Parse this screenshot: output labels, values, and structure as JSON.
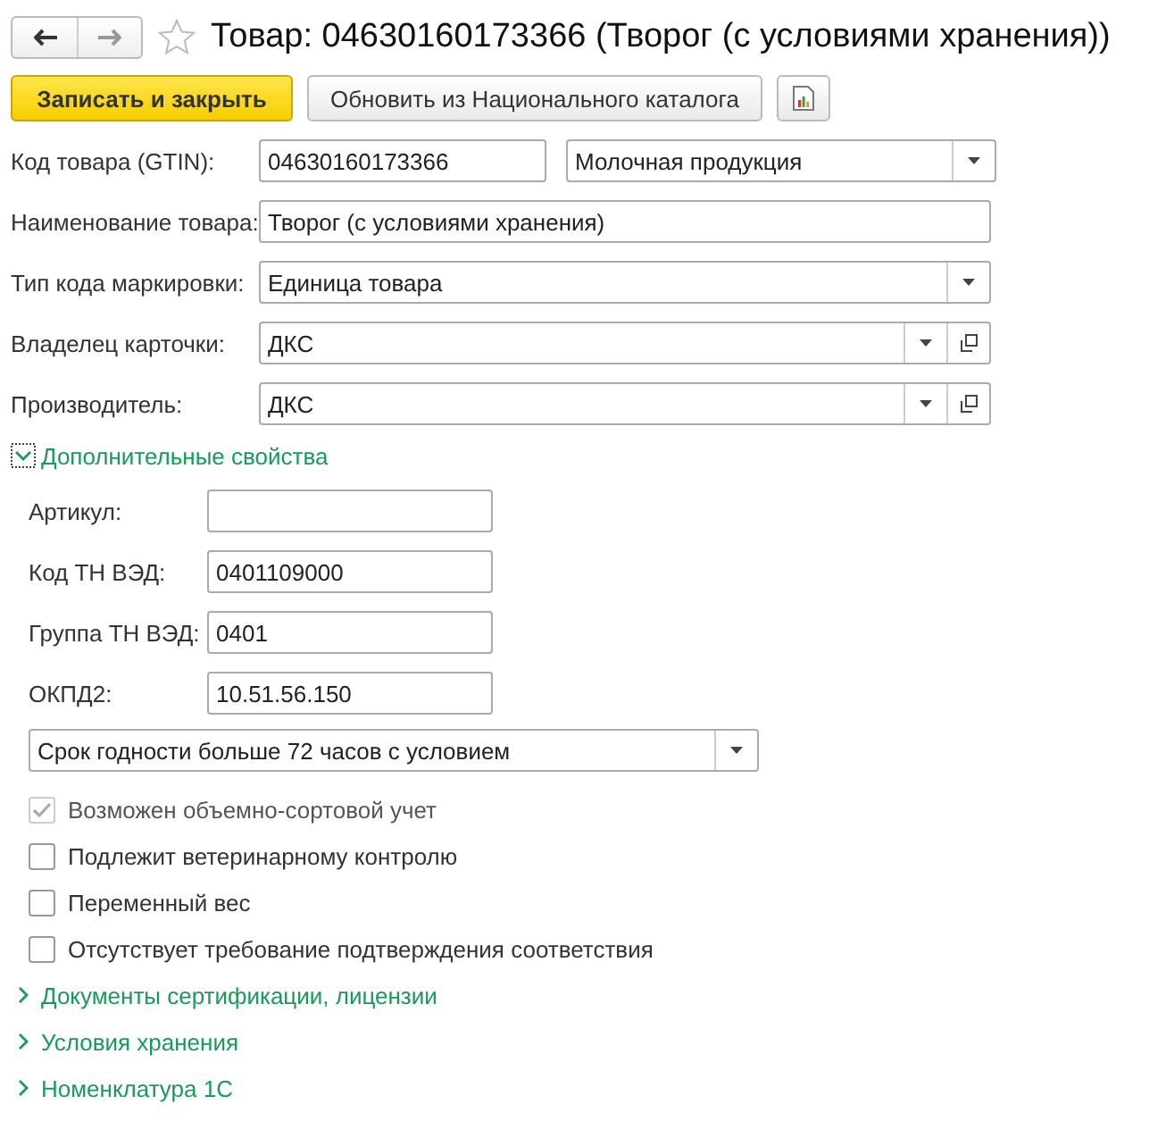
{
  "window": {
    "title": "Товар: 04630160173366 (Творог (с условиями хранения))",
    "favorite": false
  },
  "toolbar": {
    "primary": "Записать и закрыть",
    "secondary": "Обновить из Национального каталога"
  },
  "main_fields": [
    {
      "label": "Код товара (GTIN):",
      "value": "04630160173366",
      "kind": "text",
      "extra": {
        "value": "Молочная продукция",
        "kind": "select"
      }
    },
    {
      "label": "Наименование товара:",
      "value": "Творог (с условиями хранения)",
      "kind": "text"
    },
    {
      "label": "Тип кода маркировки:",
      "value": "Единица товара",
      "kind": "select"
    },
    {
      "label": "Владелец карточки:",
      "value": "ДКС",
      "kind": "select_open"
    },
    {
      "label": "Производитель:",
      "value": "ДКС",
      "kind": "select_open"
    }
  ],
  "additional": {
    "title": "Дополнительные свойства",
    "expanded": true,
    "fields": [
      {
        "label": "Артикул:"
      },
      {
        "label": "Код ТН ВЭД:",
        "value": "0401109000"
      },
      {
        "label": "Группа ТН ВЭД:",
        "value": "0401"
      },
      {
        "label": "ОКПД2:",
        "value": "10.51.56.150"
      }
    ],
    "select": {
      "value": "Срок годности больше 72 часов с условием"
    },
    "checkboxes": [
      {
        "label": "Возможен объемно-сортовой учет",
        "checked": true,
        "disabled": true
      },
      {
        "label": "Подлежит ветеринарному контролю",
        "checked": false,
        "disabled": false
      },
      {
        "label": "Переменный вес",
        "checked": false,
        "disabled": false
      },
      {
        "label": "Отсутствует требование подтверждения соответствия",
        "checked": false,
        "disabled": false
      }
    ]
  },
  "groups": [
    {
      "title": "Документы сертификации, лицензии",
      "expanded": false
    },
    {
      "title": "Условия хранения",
      "expanded": false
    },
    {
      "title": "Номенклатура 1С",
      "expanded": false
    }
  ]
}
